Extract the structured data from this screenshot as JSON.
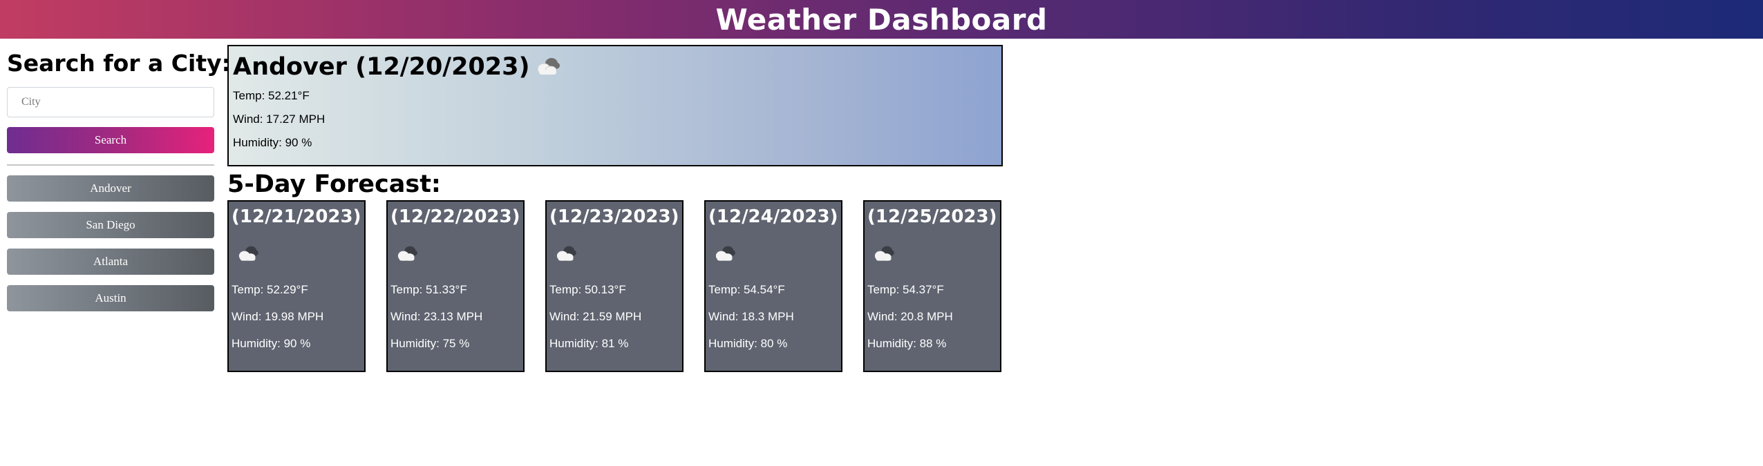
{
  "header": {
    "title": "Weather Dashboard"
  },
  "sidebar": {
    "heading": "Search for a City:",
    "search_input": {
      "placeholder": "City",
      "value": ""
    },
    "search_button_label": "Search",
    "history": [
      {
        "label": "Andover"
      },
      {
        "label": "San Diego"
      },
      {
        "label": "Atlanta"
      },
      {
        "label": "Austin"
      }
    ]
  },
  "current": {
    "title": "Andover (12/20/2023)",
    "icon": "cloud-icon",
    "temp": "Temp: 52.21°F",
    "wind": "Wind: 17.27 MPH",
    "humidity": "Humidity: 90 %"
  },
  "forecast": {
    "heading": "5-Day Forecast:",
    "days": [
      {
        "date": "(12/21/2023)",
        "icon": "cloud-icon",
        "temp": "Temp: 52.29°F",
        "wind": "Wind: 19.98 MPH",
        "humidity": "Humidity: 90 %"
      },
      {
        "date": "(12/22/2023)",
        "icon": "cloud-icon",
        "temp": "Temp: 51.33°F",
        "wind": "Wind: 23.13 MPH",
        "humidity": "Humidity: 75 %"
      },
      {
        "date": "(12/23/2023)",
        "icon": "cloud-icon",
        "temp": "Temp: 50.13°F",
        "wind": "Wind: 21.59 MPH",
        "humidity": "Humidity: 81 %"
      },
      {
        "date": "(12/24/2023)",
        "icon": "cloud-icon",
        "temp": "Temp: 54.54°F",
        "wind": "Wind: 18.3 MPH",
        "humidity": "Humidity: 80 %"
      },
      {
        "date": "(12/25/2023)",
        "icon": "cloud-icon",
        "temp": "Temp: 54.37°F",
        "wind": "Wind: 20.8 MPH",
        "humidity": "Humidity: 88 %"
      }
    ]
  },
  "colors": {
    "header_gradient": [
      "#c13c62",
      "#5a2a72",
      "#1c2a78"
    ],
    "search_button_gradient": [
      "#6f2d91",
      "#e7227b"
    ],
    "history_button_gradient": [
      "#8f959c",
      "#575c61"
    ],
    "current_gradient": [
      "#e1e9e8",
      "#8ea3d1"
    ],
    "forecast_card_bg": "#5f6470"
  }
}
